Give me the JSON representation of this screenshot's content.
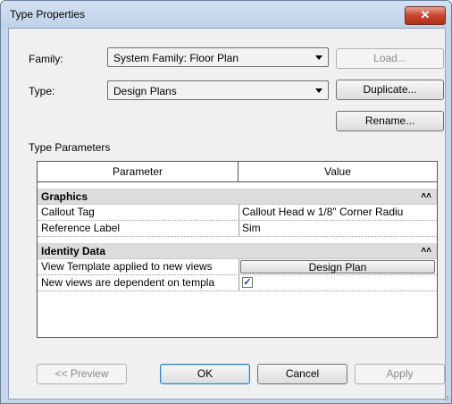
{
  "window": {
    "title": "Type Properties",
    "close_label": "✕"
  },
  "family": {
    "label": "Family:",
    "value": "System Family: Floor Plan"
  },
  "type": {
    "label": "Type:",
    "value": "Design Plans"
  },
  "buttons": {
    "load": "Load...",
    "duplicate": "Duplicate...",
    "rename": "Rename..."
  },
  "type_parameters": {
    "heading": "Type Parameters",
    "columns": [
      "Parameter",
      "Value"
    ],
    "sections": [
      {
        "name": "Graphics",
        "rows": [
          {
            "parameter": "Callout Tag",
            "value": "Callout Head w 1/8\" Corner Radiu"
          },
          {
            "parameter": "Reference Label",
            "value": "Sim"
          }
        ]
      },
      {
        "name": "Identity Data",
        "rows": [
          {
            "parameter": "View Template applied to new views",
            "value": "Design Plan"
          },
          {
            "parameter": "New views are dependent on templa",
            "value": "✓"
          }
        ]
      }
    ],
    "collapse_icon": "«"
  },
  "footer": {
    "preview": "<< Preview",
    "ok": "OK",
    "cancel": "Cancel",
    "apply": "Apply"
  }
}
